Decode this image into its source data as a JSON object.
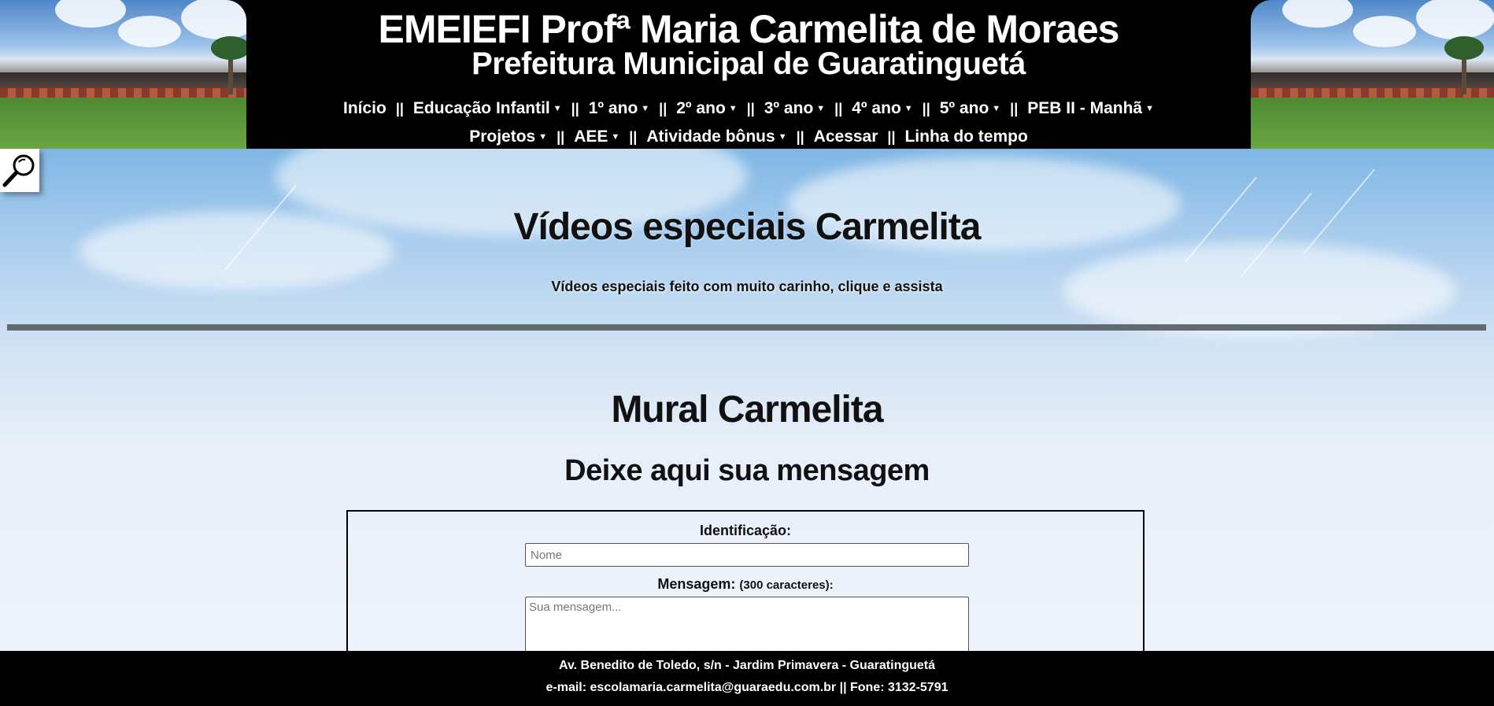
{
  "header": {
    "title": "EMEIEFI Profª Maria Carmelita de Moraes",
    "subtitle": "Prefeitura Municipal de Guaratinguetá",
    "separator": "||",
    "nav_row1": [
      {
        "label": "Início",
        "dropdown": false
      },
      {
        "label": "Educação Infantil",
        "dropdown": true
      },
      {
        "label": "1º ano",
        "dropdown": true
      },
      {
        "label": "2º ano",
        "dropdown": true
      },
      {
        "label": "3º ano",
        "dropdown": true
      },
      {
        "label": "4º ano",
        "dropdown": true
      },
      {
        "label": "5º ano",
        "dropdown": true
      },
      {
        "label": "PEB II - Manhã",
        "dropdown": true
      }
    ],
    "nav_row2": [
      {
        "label": "Projetos",
        "dropdown": true
      },
      {
        "label": "AEE",
        "dropdown": true
      },
      {
        "label": "Atividade bônus",
        "dropdown": true
      },
      {
        "label": "Acessar",
        "dropdown": false
      },
      {
        "label": "Linha do tempo",
        "dropdown": false
      }
    ],
    "caret_icon": "caret-down-icon"
  },
  "main": {
    "search_icon": "magnifier-icon",
    "videos_title": "Vídeos especiais Carmelita",
    "videos_description": "Vídeos especiais feito com muito carinho, clique e assista",
    "mural_title": "Mural Carmelita",
    "mural_subtitle": "Deixe aqui sua mensagem",
    "form": {
      "identification_label": "Identificação:",
      "name_placeholder": "Nome",
      "name_value": "",
      "message_label": "Mensagem:",
      "message_limit": "(300 caracteres):",
      "message_placeholder": "Sua mensagem...",
      "message_value": ""
    }
  },
  "footer": {
    "address": "Av. Benedito de Toledo, s/n - Jardim Primavera - Guaratinguetá",
    "contact": "e-mail: escolamaria.carmelita@guaraedu.com.br || Fone: 3132-5791"
  },
  "colors": {
    "header_bg": "#000000",
    "footer_bg": "#000000",
    "divider": "#5f6b70",
    "text_light": "#ffffff",
    "text_dark": "#111111"
  }
}
